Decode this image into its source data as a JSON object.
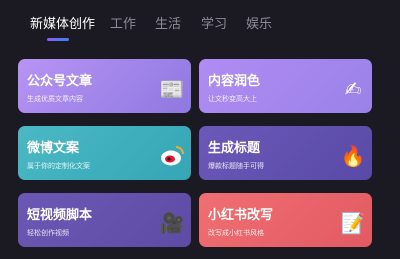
{
  "tabs": [
    {
      "label": "新媒体创作",
      "active": true
    },
    {
      "label": "工作",
      "active": false
    },
    {
      "label": "生活",
      "active": false
    },
    {
      "label": "学习",
      "active": false
    },
    {
      "label": "娱乐",
      "active": false
    }
  ],
  "cards": [
    {
      "title": "公众号文章",
      "subtitle": "生成优质文章内容",
      "icon": "newspaper-icon",
      "glyph": "📰"
    },
    {
      "title": "内容润色",
      "subtitle": "让文秒变高大上",
      "icon": "writing-hand-icon",
      "glyph": "✍"
    },
    {
      "title": "微博文案",
      "subtitle": "属于你的定制化文案",
      "icon": "weibo-icon",
      "glyph": "◉"
    },
    {
      "title": "生成标题",
      "subtitle": "爆款标题随手可得",
      "icon": "fire-icon",
      "glyph": "🔥"
    },
    {
      "title": "短视频脚本",
      "subtitle": "轻松创作视频",
      "icon": "film-camera-icon",
      "glyph": "🎥"
    },
    {
      "title": "小红书改写",
      "subtitle": "改写成小红书风格",
      "icon": "memo-icon",
      "glyph": "📝"
    }
  ]
}
